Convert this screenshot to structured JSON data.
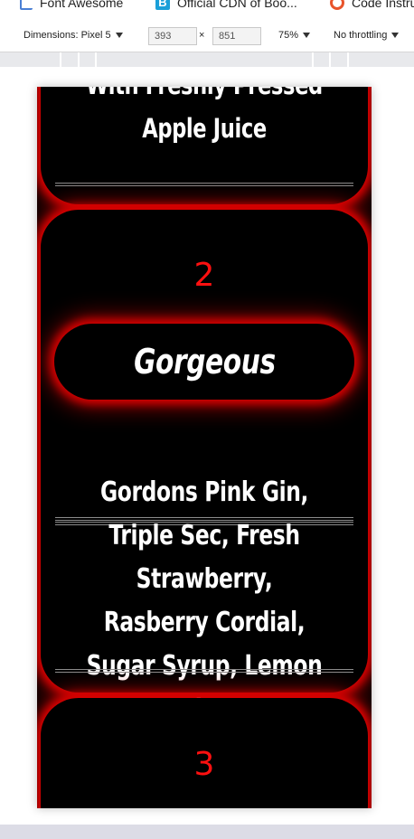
{
  "bookmarks": [
    {
      "label": "Font Awesome"
    },
    {
      "label": "Official CDN of Boo..."
    },
    {
      "label": "Code Instru"
    }
  ],
  "devtools": {
    "device_label": "Dimensions: Pixel 5",
    "width_value": "393",
    "height_value": "851",
    "times_symbol": "×",
    "zoom_label": "75%",
    "throttle_label": "No throttling"
  },
  "cards": [
    {
      "description": "Lemon Juice, Topped With Freshly Pressed Apple Juice"
    },
    {
      "number": "2",
      "name": "Gorgeous",
      "description": "Gordons Pink Gin, Triple Sec, Fresh Strawberry, Rasberry Cordial, Sugar Syrup, Lemon Juice."
    },
    {
      "number": "3"
    }
  ],
  "colors": {
    "accent": "#ff1010",
    "glow": "#e00000",
    "card_bg": "#000000"
  }
}
